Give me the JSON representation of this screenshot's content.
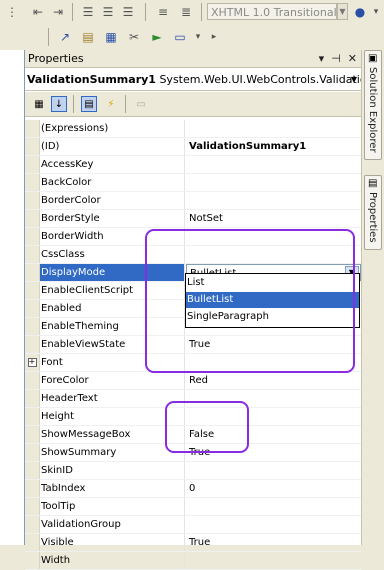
{
  "toolbar": {
    "doctype_label": "XHTML 1.0 Transitional (",
    "icons_top": [
      "align-left-icon",
      "align-center-icon",
      "align-right-icon",
      "outdent-icon",
      "indent-icon",
      "list-icon",
      "numbered-list-icon"
    ],
    "icons_second": [
      "snap-icon",
      "properties-page-icon",
      "design-icon",
      "tools-icon",
      "run-icon",
      "form-icon"
    ]
  },
  "panel": {
    "title": "Properties",
    "title_controls": [
      "▾",
      "⊣",
      "✕"
    ],
    "object_name": "ValidationSummary1",
    "object_type": "System.Web.UI.WebControls.ValidationS"
  },
  "grid": {
    "rows": [
      {
        "name": "(Expressions)",
        "value": ""
      },
      {
        "name": "(ID)",
        "value": "ValidationSummary1"
      },
      {
        "name": "AccessKey",
        "value": ""
      },
      {
        "name": "BackColor",
        "value": ""
      },
      {
        "name": "BorderColor",
        "value": ""
      },
      {
        "name": "BorderStyle",
        "value": "NotSet"
      },
      {
        "name": "BorderWidth",
        "value": ""
      },
      {
        "name": "CssClass",
        "value": ""
      },
      {
        "name": "DisplayMode",
        "value": "BulletList"
      },
      {
        "name": "EnableClientScript",
        "value": ""
      },
      {
        "name": "Enabled",
        "value": ""
      },
      {
        "name": "EnableTheming",
        "value": ""
      },
      {
        "name": "EnableViewState",
        "value": "True"
      },
      {
        "name": "Font",
        "value": ""
      },
      {
        "name": "ForeColor",
        "value": "Red"
      },
      {
        "name": "HeaderText",
        "value": ""
      },
      {
        "name": "Height",
        "value": ""
      },
      {
        "name": "ShowMessageBox",
        "value": "False"
      },
      {
        "name": "ShowSummary",
        "value": "True"
      },
      {
        "name": "SkinID",
        "value": ""
      },
      {
        "name": "TabIndex",
        "value": "0"
      },
      {
        "name": "ToolTip",
        "value": ""
      },
      {
        "name": "ValidationGroup",
        "value": ""
      },
      {
        "name": "Visible",
        "value": "True"
      },
      {
        "name": "Width",
        "value": ""
      }
    ]
  },
  "dropdown": {
    "options": [
      "List",
      "BulletList",
      "SingleParagraph"
    ],
    "selected": "BulletList"
  },
  "side_tabs": {
    "solution_explorer": "Solution Explorer",
    "properties": "Properties"
  },
  "colors": {
    "selection": "#316ac5",
    "annotation": "#8a2be2",
    "chrome": "#ece9d8"
  }
}
